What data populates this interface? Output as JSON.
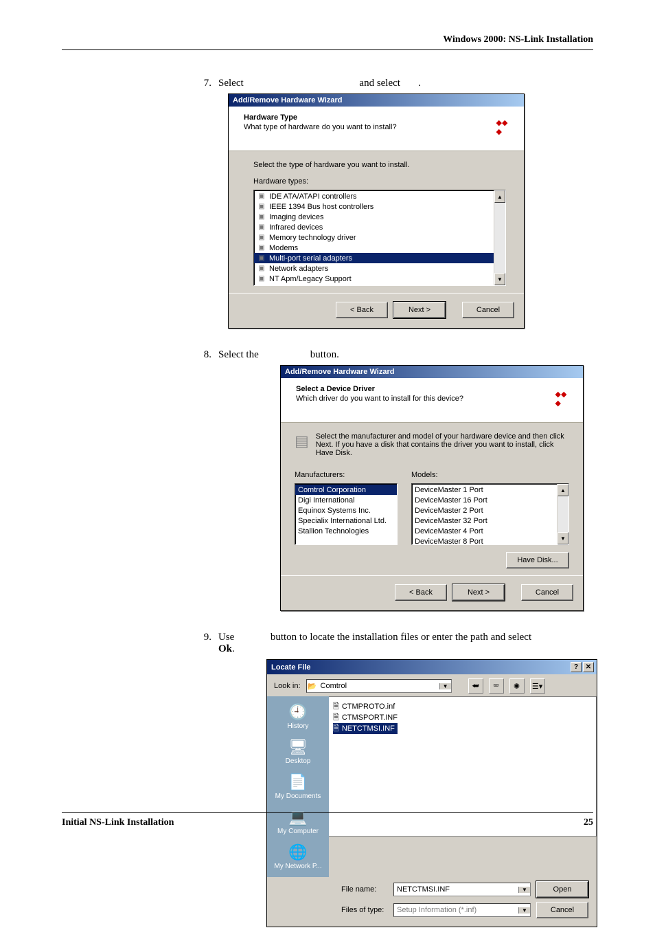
{
  "running_head": "Windows 2000: NS-Link Installation",
  "footer": {
    "left": "Initial NS-Link Installation",
    "right": "25"
  },
  "steps": {
    "s7": {
      "num": "7.",
      "text_a": "Select ",
      "text_b": " and select ",
      "text_c": "."
    },
    "s8": {
      "num": "8.",
      "text_a": "Select the ",
      "text_b": " button."
    },
    "s9": {
      "num": "9.",
      "text_a": "Use ",
      "text_b": " button to locate the installation files or enter the path and select ",
      "ok": "Ok",
      "dot": "."
    }
  },
  "dlg7": {
    "title": "Add/Remove Hardware Wizard",
    "head_bold": "Hardware Type",
    "head_sub": "What type of hardware do you want to install?",
    "prompt": "Select the type of hardware you want to install.",
    "list_label": "Hardware types:",
    "items": [
      "IDE ATA/ATAPI controllers",
      "IEEE 1394 Bus host controllers",
      "Imaging devices",
      "Infrared devices",
      "Memory technology driver",
      "Modems",
      "Multi-port serial adapters",
      "Network adapters",
      "NT Apm/Legacy Support"
    ],
    "selected_index": 6,
    "btn_back": "< Back",
    "btn_next": "Next >",
    "btn_cancel": "Cancel"
  },
  "dlg8": {
    "title": "Add/Remove Hardware Wizard",
    "head_bold": "Select a Device Driver",
    "head_sub": "Which driver do you want to install for this device?",
    "instr": "Select the manufacturer and model of your hardware device and then click Next. If you have a disk that contains the driver you want to install, click Have Disk.",
    "mfr_label": "Manufacturers:",
    "mdl_label": "Models:",
    "mfrs": [
      "Comtrol Corporation",
      "Digi International",
      "Equinox Systems Inc.",
      "Specialix International Ltd.",
      "Stallion Technologies"
    ],
    "mfr_selected": 0,
    "models": [
      "DeviceMaster 1 Port",
      "DeviceMaster 16 Port",
      "DeviceMaster 2 Port",
      "DeviceMaster 32 Port",
      "DeviceMaster 4 Port",
      "DeviceMaster 8 Port"
    ],
    "have_disk": "Have Disk...",
    "btn_back": "< Back",
    "btn_next": "Next >",
    "btn_cancel": "Cancel"
  },
  "dlg9": {
    "title": "Locate File",
    "lookin_label": "Look in:",
    "lookin_value": "Comtrol",
    "toolbar_icons": [
      "back",
      "up",
      "new-folder",
      "views"
    ],
    "places": [
      "History",
      "Desktop",
      "My Documents",
      "My Computer",
      "My Network P..."
    ],
    "files": [
      "CTMPROTO.inf",
      "CTMSPORT.INF",
      "NETCTMSI.INF"
    ],
    "file_selected": 2,
    "filename_label": "File name:",
    "filename_value": "NETCTMSI.INF",
    "filetype_label": "Files of type:",
    "filetype_value": "Setup Information (*.inf)",
    "btn_open": "Open",
    "btn_cancel": "Cancel"
  }
}
